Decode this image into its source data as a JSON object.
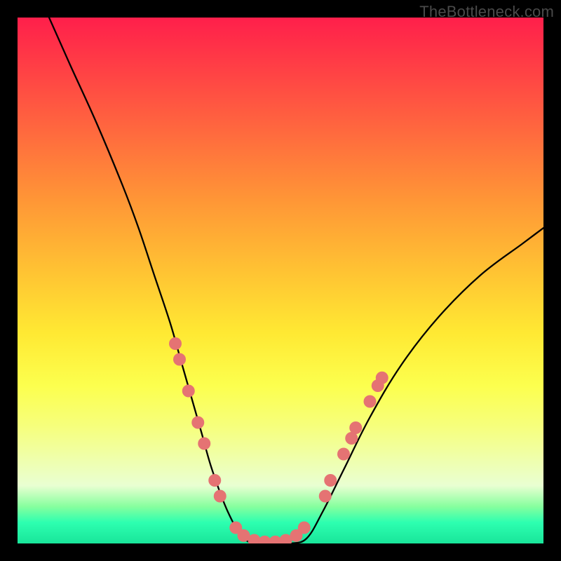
{
  "watermark": "TheBottleneck.com",
  "chart_data": {
    "type": "line",
    "title": "",
    "xlabel": "",
    "ylabel": "",
    "xlim": [
      0,
      100
    ],
    "ylim": [
      0,
      100
    ],
    "series": [
      {
        "name": "bottleneck-curve",
        "x": [
          6,
          10,
          15,
          20,
          23,
          26,
          29,
          31,
          33,
          35,
          37,
          40,
          43,
          46,
          49,
          52,
          55,
          58,
          62,
          67,
          73,
          80,
          88,
          96,
          100
        ],
        "values": [
          100,
          91,
          80,
          68,
          60,
          51,
          42,
          35,
          28,
          21,
          14,
          6,
          1,
          0,
          0,
          0,
          1,
          6,
          14,
          24,
          34,
          43,
          51,
          57,
          60
        ]
      }
    ],
    "markers": {
      "name": "highlight-dots",
      "color": "#e57373",
      "points": [
        {
          "x": 30.0,
          "y": 38
        },
        {
          "x": 30.8,
          "y": 35
        },
        {
          "x": 32.5,
          "y": 29
        },
        {
          "x": 34.3,
          "y": 23
        },
        {
          "x": 35.5,
          "y": 19
        },
        {
          "x": 37.5,
          "y": 12
        },
        {
          "x": 38.5,
          "y": 9
        },
        {
          "x": 41.5,
          "y": 3
        },
        {
          "x": 43.0,
          "y": 1.5
        },
        {
          "x": 45.0,
          "y": 0.6
        },
        {
          "x": 47.0,
          "y": 0.3
        },
        {
          "x": 49.0,
          "y": 0.3
        },
        {
          "x": 51.0,
          "y": 0.6
        },
        {
          "x": 53.0,
          "y": 1.5
        },
        {
          "x": 54.5,
          "y": 3
        },
        {
          "x": 58.5,
          "y": 9
        },
        {
          "x": 59.5,
          "y": 12
        },
        {
          "x": 62.0,
          "y": 17
        },
        {
          "x": 63.5,
          "y": 20
        },
        {
          "x": 64.3,
          "y": 22
        },
        {
          "x": 67.0,
          "y": 27
        },
        {
          "x": 68.5,
          "y": 30
        },
        {
          "x": 69.3,
          "y": 31.5
        }
      ]
    }
  }
}
